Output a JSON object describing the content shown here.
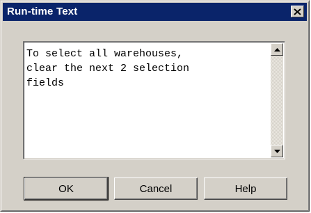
{
  "window": {
    "title": "Run-time Text",
    "close_icon": "close-icon"
  },
  "textbox": {
    "value": "To select all warehouses,\nclear the next 2 selection\nfields",
    "scroll_up_icon": "scroll-up-arrow-icon",
    "scroll_down_icon": "scroll-down-arrow-icon"
  },
  "buttons": {
    "ok_label": "OK",
    "cancel_label": "Cancel",
    "help_label": "Help"
  },
  "colors": {
    "titlebar": "#0a246a",
    "face": "#d4d0c8",
    "text_background": "#ffffff"
  }
}
